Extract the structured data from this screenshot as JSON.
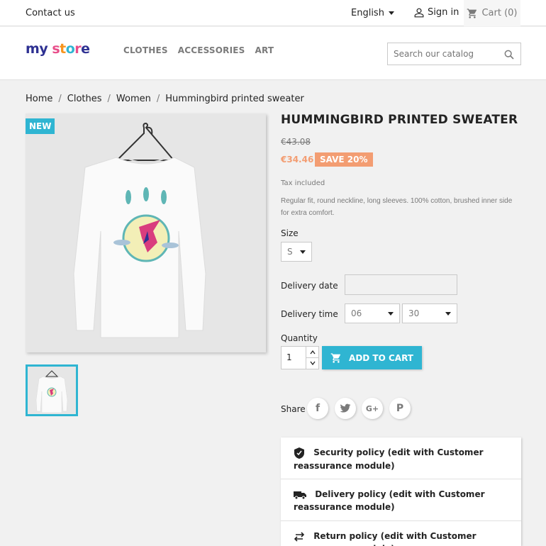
{
  "topbar": {
    "contact": "Contact us",
    "language": "English",
    "signin": "Sign in",
    "cart": "Cart (0)"
  },
  "header": {
    "logo_text": [
      "m",
      "y",
      " ",
      "s",
      "t",
      "o",
      "r",
      "e"
    ],
    "nav": [
      "CLOTHES",
      "ACCESSORIES",
      "ART"
    ],
    "search_placeholder": "Search our catalog"
  },
  "breadcrumb": [
    "Home",
    "Clothes",
    "Women",
    "Hummingbird printed sweater"
  ],
  "product": {
    "badge": "NEW",
    "title": "HUMMINGBIRD PRINTED SWEATER",
    "old_price": "€43.08",
    "price": "€34.46",
    "save": "SAVE 20%",
    "tax": "Tax included",
    "description": "Regular fit, round neckline, long sleeves. 100% cotton, brushed inner side for extra comfort."
  },
  "options": {
    "size_label": "Size",
    "size_value": "S",
    "delivery_date_label": "Delivery date",
    "delivery_time_label": "Delivery time",
    "hour_value": "06",
    "minute_value": "30",
    "quantity_label": "Quantity",
    "quantity_value": "1",
    "add_to_cart": "ADD TO CART"
  },
  "share": {
    "label": "Share",
    "networks": [
      "f",
      "t",
      "G+",
      "P"
    ]
  },
  "reassurance": [
    "Security policy (edit with Customer reassurance module)",
    "Delivery policy (edit with Customer reassurance module)",
    "Return policy (edit with Customer reassurance module)"
  ],
  "colors": {
    "accent": "#2fb5d2",
    "price": "#f39d72",
    "logo": [
      "#2e3192",
      "#2e3192",
      "#ffffff",
      "#e84e8a",
      "#f7941d",
      "#2fb5d2",
      "#e84e8a",
      "#2e3192"
    ]
  }
}
